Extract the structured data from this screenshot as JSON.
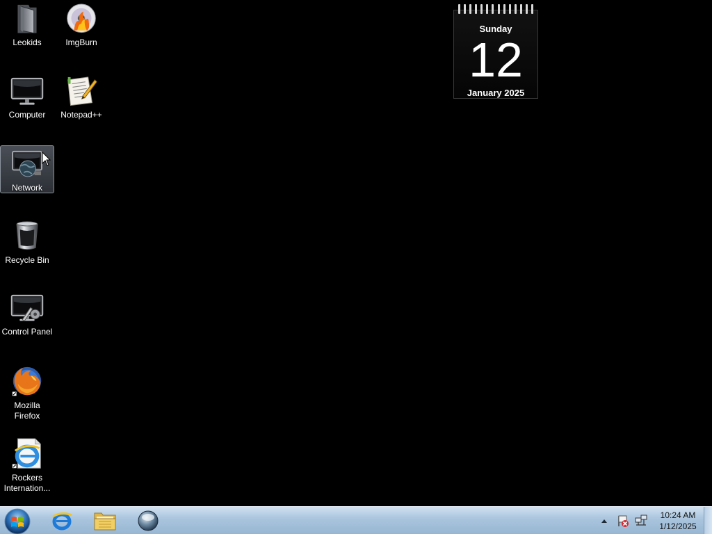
{
  "desktop": {
    "icons": [
      {
        "label": "Leokids",
        "icon": "folder-icon"
      },
      {
        "label": "ImgBurn",
        "icon": "imgburn-icon"
      },
      {
        "label": "Computer",
        "icon": "computer-icon"
      },
      {
        "label": "Notepad++",
        "icon": "notepad-icon"
      },
      {
        "label": "Network",
        "icon": "network-icon",
        "selected": true
      },
      {
        "label": "Recycle Bin",
        "icon": "recycle-bin-icon"
      },
      {
        "label": "Control Panel",
        "icon": "control-panel-icon"
      },
      {
        "label": "Mozilla Firefox",
        "icon": "firefox-icon"
      },
      {
        "label": "Rockers Internation...",
        "icon": "internet-explorer-shortcut-icon"
      }
    ]
  },
  "calendar_gadget": {
    "day_name": "Sunday",
    "date": "12",
    "month_year": "January 2025"
  },
  "taskbar": {
    "start_icon": "windows-start-icon",
    "pinned": [
      {
        "icon": "internet-explorer-icon"
      },
      {
        "icon": "windows-explorer-icon"
      },
      {
        "icon": "media-player-icon"
      }
    ],
    "tray": {
      "icons": [
        "show-hidden-icons-arrow",
        "action-center-icon",
        "network-tray-icon"
      ],
      "time": "10:24 AM",
      "date": "1/12/2025"
    }
  }
}
